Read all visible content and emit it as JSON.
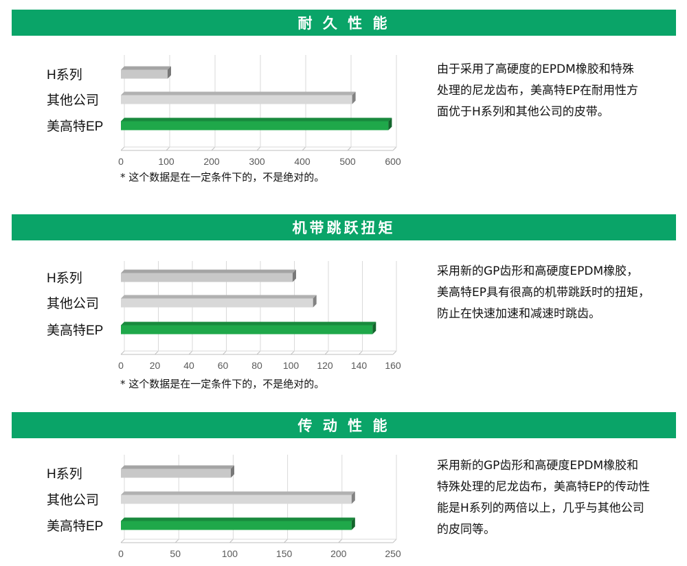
{
  "sections": [
    {
      "title": "耐 久 性 能",
      "description": [
        "由于采用了高硬度的EPDM橡胶和特殊",
        "处理的尼龙齿布，美高特EP在耐用性方",
        "面优于H系列和其他公司的皮带。"
      ],
      "note": "* 这个数据是在一定条件下的，不是绝对的。"
    },
    {
      "title": "机带跳跃扭矩",
      "description": [
        "采用新的GP齿形和高硬度EPDM橡胶，",
        "美高特EP具有很高的机带跳跃时的扭矩，",
        "防止在快速加速和减速时跳齿。"
      ],
      "note": "* 这个数据是在一定条件下的，不是绝对的。"
    },
    {
      "title": "传 动 性 能",
      "description": [
        "采用新的GP齿形和高硬度EPDM橡胶和",
        "特殊处理的尼龙齿布，美高特EP的传动性",
        "能是H系列的两倍以上，几乎与其他公司",
        "的皮同等。"
      ],
      "note": ""
    }
  ],
  "chart_data": [
    {
      "type": "bar",
      "orientation": "horizontal",
      "categories": [
        "H系列",
        "其他公司",
        "美高特EP"
      ],
      "values": [
        103,
        510,
        590
      ],
      "xlim": [
        0,
        600
      ],
      "xticks": [
        "0",
        "100",
        "200",
        "300",
        "400",
        "500",
        "600"
      ],
      "colors": [
        "#c8c8c8",
        "#d8d8d8",
        "#1fa84a"
      ],
      "grid": "vertical"
    },
    {
      "type": "bar",
      "orientation": "horizontal",
      "categories": [
        "H系列",
        "其他公司",
        "美高特EP"
      ],
      "values": [
        101,
        113,
        148
      ],
      "xlim": [
        0,
        160
      ],
      "xticks": [
        "0",
        "20",
        "40",
        "60",
        "80",
        "100",
        "120",
        "140",
        "160"
      ],
      "colors": [
        "#c8c8c8",
        "#d8d8d8",
        "#1fa84a"
      ],
      "grid": "vertical"
    },
    {
      "type": "bar",
      "orientation": "horizontal",
      "categories": [
        "H系列",
        "其他公司",
        "美高特EP"
      ],
      "values": [
        101,
        212,
        212
      ],
      "xlim": [
        0,
        250
      ],
      "xticks": [
        "0",
        "50",
        "100",
        "150",
        "200",
        "250"
      ],
      "colors": [
        "#c8c8c8",
        "#d8d8d8",
        "#1fa84a"
      ],
      "grid": "vertical"
    }
  ]
}
